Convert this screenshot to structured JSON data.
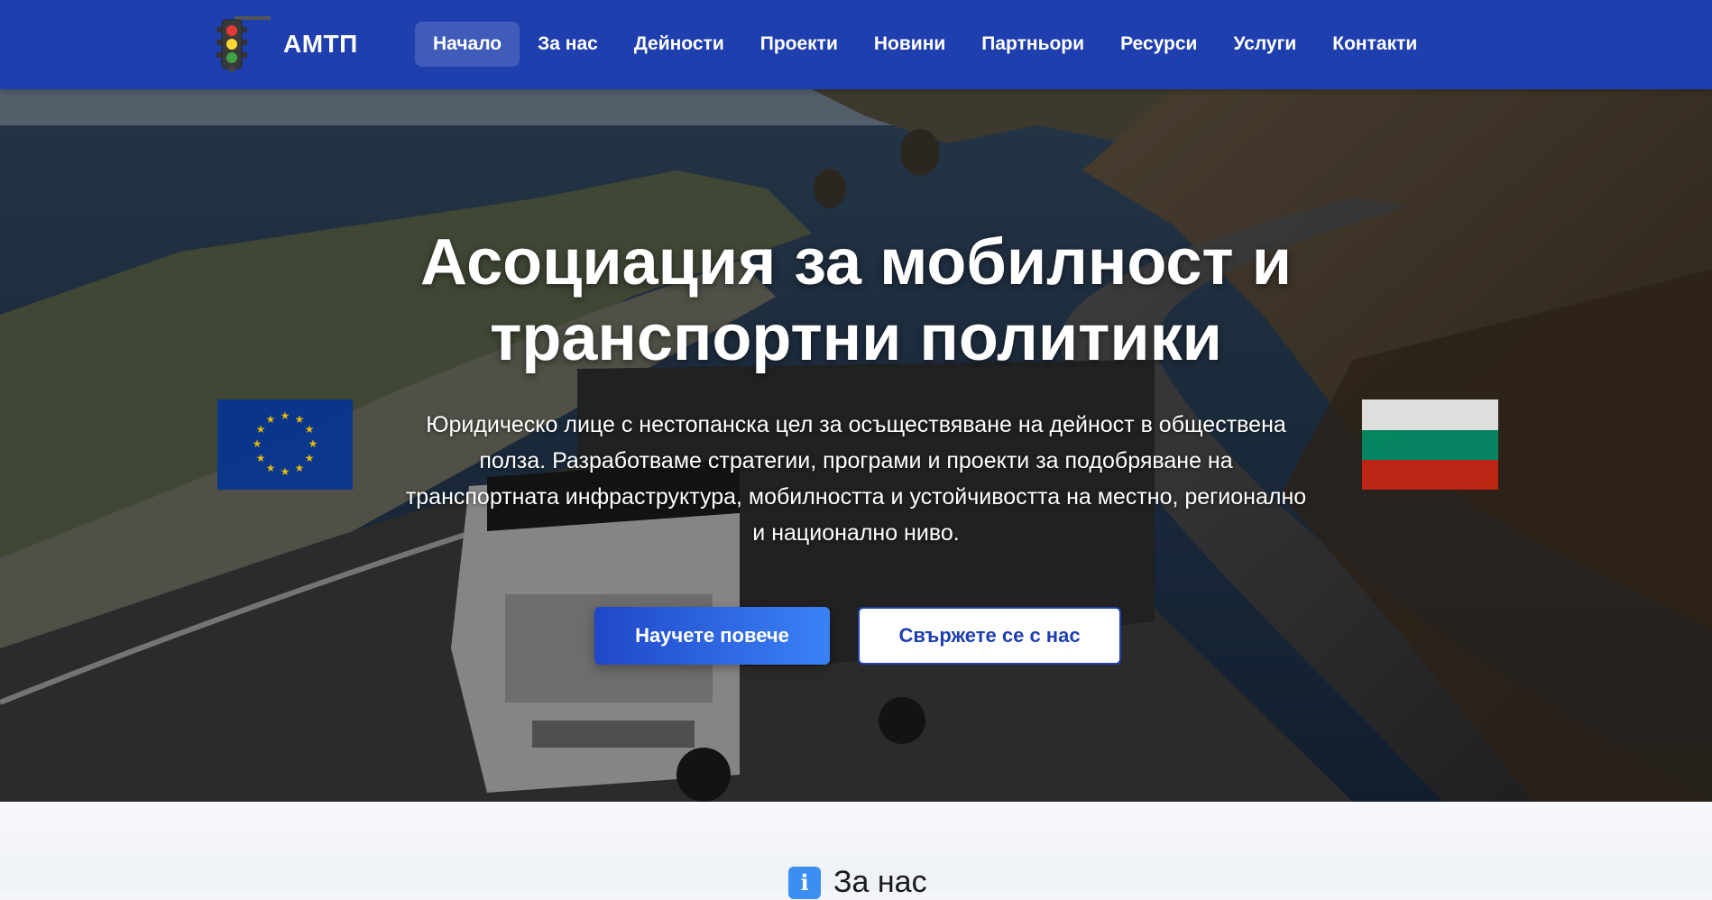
{
  "brand": {
    "name": "АМТП",
    "logo_icon": "traffic-light-icon"
  },
  "nav": {
    "items": [
      {
        "label": "Начало",
        "active": true
      },
      {
        "label": "За нас",
        "active": false
      },
      {
        "label": "Дейности",
        "active": false
      },
      {
        "label": "Проекти",
        "active": false
      },
      {
        "label": "Новини",
        "active": false
      },
      {
        "label": "Партньори",
        "active": false
      },
      {
        "label": "Ресурси",
        "active": false
      },
      {
        "label": "Услуги",
        "active": false
      },
      {
        "label": "Контакти",
        "active": false
      }
    ]
  },
  "hero": {
    "title": "Асоциация за мобилност и транспортни политики",
    "description": "Юридическо лице с нестопанска цел за осъществяване на дейност в обществена полза. Разработваме стратегии, програми и проекти за подобряване на транспортната инфраструктура, мобилността и устойчивостта на местно, регионално и национално ниво.",
    "primary_button": "Научете повече",
    "secondary_button": "Свържете се с нас",
    "left_flag": "eu-flag-icon",
    "right_flag": "bulgaria-flag-icon"
  },
  "about_section": {
    "icon": "info-icon",
    "icon_glyph": "i",
    "title": "За нас"
  },
  "colors": {
    "nav_bg": "#1f3fae",
    "primary": "#2563eb",
    "eu_blue": "#003399",
    "eu_gold": "#ffcc00",
    "bg_white": "#ffffff",
    "bg_green": "#00966e",
    "bg_red": "#d62612"
  }
}
